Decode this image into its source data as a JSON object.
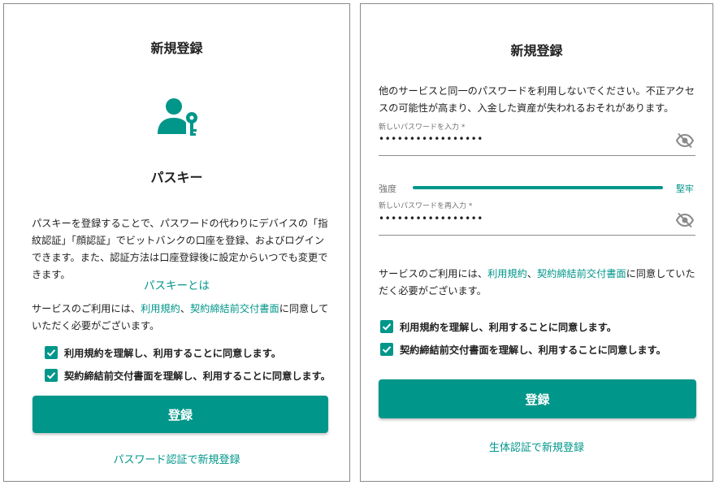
{
  "left": {
    "title": "新規登録",
    "passkey_heading": "パスキー",
    "description": "パスキーを登録することで、パスワードの代わりにデバイスの「指紋認証」「顔認証」でビットバンクの口座を登録、およびログインできます。また、認証方法は口座登録後に設定からいつでも変更できます。",
    "passkey_about": "パスキーとは",
    "terms": {
      "prefix": "サービスのご利用には、",
      "link1": "利用規約",
      "sep": "、",
      "link2": "契約締結前交付書面",
      "suffix": "に同意していただく必要がございます。"
    },
    "checkbox1": "利用規約を理解し、利用することに同意します。",
    "checkbox2": "契約締結前交付書面を理解し、利用することに同意します。",
    "register_button": "登録",
    "bottom_link": "パスワード認証で新規登録"
  },
  "right": {
    "title": "新規登録",
    "warning": "他のサービスと同一のパスワードを利用しないでください。不正アクセスの可能性が高まり、入金した資産が失われるおそれがあります。",
    "password_label": "新しいパスワードを入力 *",
    "password_value": "•••••••••••••••••",
    "strength_label": "強度",
    "strength_value": "堅牢",
    "strength_fraction": 1.0,
    "confirm_label": "新しいパスワードを再入力 *",
    "confirm_value": "•••••••••••••••••",
    "terms": {
      "prefix": "サービスのご利用には、",
      "link1": "利用規約",
      "sep": "、",
      "link2": "契約締結前交付書面",
      "suffix": "に同意していただく必要がございます。"
    },
    "checkbox1": "利用規約を理解し、利用することに同意します。",
    "checkbox2": "契約締結前交付書面を理解し、利用することに同意します。",
    "register_button": "登録",
    "bottom_link": "生体認証で新規登録"
  },
  "colors": {
    "accent": "#00968A",
    "text": "#212121",
    "muted": "#707070"
  }
}
